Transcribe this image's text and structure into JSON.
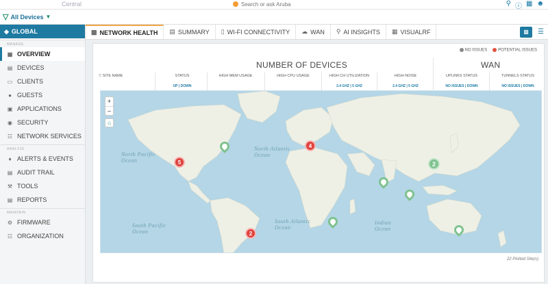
{
  "topbar": {
    "brand": "Central",
    "search_placeholder": "Search or ask Aruba"
  },
  "filter": {
    "label": "All Devices"
  },
  "sidebar": {
    "global": "GLOBAL",
    "section_manage": "MANAGE",
    "section_analyze": "ANALYZE",
    "section_maintain": "MAINTAIN",
    "manage": [
      {
        "label": "OVERVIEW",
        "icon": "grid-icon"
      },
      {
        "label": "DEVICES",
        "icon": "devices-icon"
      },
      {
        "label": "CLIENTS",
        "icon": "clients-icon"
      },
      {
        "label": "GUESTS",
        "icon": "guests-icon"
      },
      {
        "label": "APPLICATIONS",
        "icon": "applications-icon"
      },
      {
        "label": "SECURITY",
        "icon": "security-icon"
      },
      {
        "label": "NETWORK SERVICES",
        "icon": "network-services-icon"
      }
    ],
    "analyze": [
      {
        "label": "ALERTS & EVENTS",
        "icon": "bell-icon"
      },
      {
        "label": "AUDIT TRAIL",
        "icon": "audit-icon"
      },
      {
        "label": "TOOLS",
        "icon": "tools-icon"
      },
      {
        "label": "REPORTS",
        "icon": "reports-icon"
      }
    ],
    "maintain": [
      {
        "label": "FIRMWARE",
        "icon": "firmware-icon"
      },
      {
        "label": "ORGANIZATION",
        "icon": "organization-icon"
      }
    ]
  },
  "tabs": [
    {
      "label": "NETWORK HEALTH"
    },
    {
      "label": "SUMMARY"
    },
    {
      "label": "WI-FI CONNECTIVITY"
    },
    {
      "label": "WAN"
    },
    {
      "label": "AI INSIGHTS"
    },
    {
      "label": "VISUALRF"
    }
  ],
  "legend": {
    "no_issues": "NO ISSUES",
    "potential_issues": "POTENTIAL ISSUES",
    "green": "#8a8a8a",
    "red": "#e0533f"
  },
  "titles": {
    "devices": "NUMBER OF DEVICES",
    "wan": "WAN"
  },
  "columns": {
    "site_name": "SITE NAME",
    "status": "STATUS",
    "status_sub": "UP | DOWN",
    "mem": "HIGH MEM USAGE",
    "cpu": "HIGH CPU USAGE",
    "ch_util": "HIGH CH UTILIZATION",
    "ch_util_sub": "2.4 GHz | 5 GHz",
    "noise": "HIGH NOISE",
    "noise_sub": "2.4 GHz | 5 GHz",
    "uplinks": "UPLINKS STATUS",
    "uplinks_sub": "NO ISSUES | DOWN",
    "tunnels": "TUNNELS STATUS",
    "tunnels_sub": "NO ISSUES | DOWN"
  },
  "map": {
    "labels": {
      "north_pacific": "North Pacific Ocean",
      "north_atlantic": "North Atlantic Ocean",
      "south_pacific": "South Pacific Ocean",
      "south_atlantic": "South Atlantic Ocean",
      "indian": "Indian Ocean"
    },
    "clusters_red": [
      "5",
      "4",
      "2"
    ],
    "clusters_green": [
      "2"
    ]
  },
  "footer": "22 Plotted Site(s)"
}
